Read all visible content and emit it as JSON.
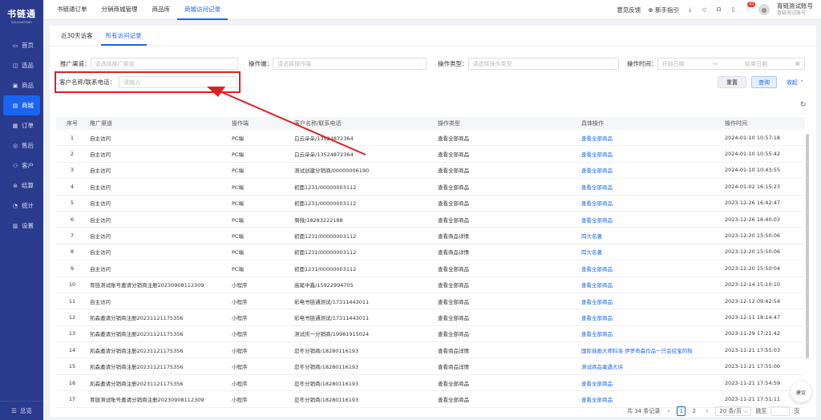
{
  "sidebar": {
    "logo": "书链通",
    "logo_sub": "SHULIANTONG",
    "items": [
      {
        "icon": "monitor-icon",
        "glyph": "▭",
        "label": "首页"
      },
      {
        "icon": "bag-icon",
        "glyph": "◫",
        "label": "选品"
      },
      {
        "icon": "box-icon",
        "glyph": "▣",
        "label": "商品"
      },
      {
        "icon": "store-icon",
        "glyph": "▤",
        "label": "商城"
      },
      {
        "icon": "order-icon",
        "glyph": "▦",
        "label": "订单"
      },
      {
        "icon": "refund-icon",
        "glyph": "◎",
        "label": "售后"
      },
      {
        "icon": "users-icon",
        "glyph": "⚇",
        "label": "客户"
      },
      {
        "icon": "settle-icon",
        "glyph": "⊛",
        "label": "结算"
      },
      {
        "icon": "stats-icon",
        "glyph": "◔",
        "label": "统计"
      },
      {
        "icon": "settings-icon",
        "glyph": "▥",
        "label": "设置"
      }
    ],
    "active_index": 3,
    "collapse_label": "总览"
  },
  "topbar": {
    "tabs": [
      "书链通订单",
      "分销商城管理",
      "商品库",
      "商城访问记录"
    ],
    "active_tab": 3,
    "feedback": "意见反馈",
    "guide": "新手指引",
    "badge": "32",
    "account_name": "育链测试账号",
    "account_sub": "育链测试账号"
  },
  "subtabs": [
    "近30天访客",
    "所有访问记录"
  ],
  "active_subtab": 1,
  "filters": {
    "channel_label": "推广渠道：",
    "channel_placeholder": "请选择推广渠道",
    "device_label": "操作端：",
    "device_placeholder": "请选择操作端",
    "type_label": "操作类型：",
    "type_placeholder": "请选择操作类型",
    "time_label": "操作时间：",
    "start_placeholder": "开始日期",
    "end_placeholder": "结束日期",
    "customer_label": "客户名称/联系电话：",
    "customer_placeholder": "请输入",
    "reset": "重置",
    "query": "查询",
    "fold": "收起"
  },
  "table": {
    "headers": [
      "序号",
      "推广渠道",
      "操作端",
      "客户名称/联系电话",
      "操作类型",
      "具体操作",
      "操作时间"
    ],
    "rows": [
      [
        "1",
        "自主访问",
        "PC端",
        "白云朵朵/13524872364",
        "查看全部商品",
        "查看全部商品",
        "2024-01-10 10:57:18"
      ],
      [
        "2",
        "自主访问",
        "PC端",
        "白云朵朵/13524872364",
        "查看全部商品",
        "查看全部商品",
        "2024-01-10 10:55:42"
      ],
      [
        "3",
        "自主访问",
        "PC端",
        "测试创建分销商/00000006190",
        "查看全部商品",
        "查看全部商品",
        "2024-01-10 10:43:55"
      ],
      [
        "4",
        "自主访问",
        "PC端",
        "初面1231/00000003112",
        "查看全部商品",
        "查看全部商品",
        "2024-01-02 16:15:23"
      ],
      [
        "5",
        "自主访问",
        "PC端",
        "初面1231/00000003112",
        "查看全部商品",
        "查看全部商品",
        "2023-12-26 16:42:47"
      ],
      [
        "6",
        "自主访问",
        "PC端",
        "周微/18283222188",
        "查看全部商品",
        "查看全部商品",
        "2023-12-26 16:40:03"
      ],
      [
        "7",
        "自主访问",
        "PC端",
        "初面1231/00000003112",
        "查看商品详情",
        "四大名著",
        "2023-12-20 15:50:06"
      ],
      [
        "8",
        "自主访问",
        "PC端",
        "初面1231/00000003112",
        "查看商品详情",
        "四大名著",
        "2023-12-20 15:50:06"
      ],
      [
        "9",
        "自主访问",
        "PC端",
        "初面1231/00000003112",
        "查看全部商品",
        "查看全部商品",
        "2023-12-20 15:50:04"
      ],
      [
        "10",
        "育链测试账号邀请分销商注册20230908112309",
        "小程序",
        "高尾中鑫/15922994705",
        "查看全部商品",
        "查看全部商品",
        "2023-12-14 15:10:10"
      ],
      [
        "11",
        "自主访问",
        "小程序",
        "彩电书链通测试/17311443011",
        "查看全部商品",
        "查看全部商品",
        "2023-12-12 09:42:54"
      ],
      [
        "12",
        "凯森邀请分销商注册20231121175356",
        "小程序",
        "彩电书链通测试/17311443011",
        "查看全部商品",
        "查看全部商品",
        "2023-12-11 18:14:47"
      ],
      [
        "13",
        "凯森邀请分销商注册20231121175356",
        "小程序",
        "测试庆一分销商/19981915024",
        "查看全部商品",
        "查看全部商品",
        "2023-11-29 17:21:42"
      ],
      [
        "14",
        "凯森邀请分销商注册20231121175356",
        "小程序",
        "忍冬分销商/18280116193",
        "查看商品详情",
        "国际插画大师科洛·伊罗奇森作品一只会挖宝的狗",
        "2023-11-21 17:55:03"
      ],
      [
        "15",
        "凯森邀请分销商注册20231121175356",
        "小程序",
        "忍冬分销商/18280116193",
        "查看商品详情",
        "测试商品毫遇大块",
        "2023-11-21 17:55:00"
      ],
      [
        "16",
        "凯森邀请分销商注册20231121175356",
        "小程序",
        "忍冬分销商/18280116193",
        "查看全部商品",
        "查看全部商品",
        "2023-11-21 17:54:59"
      ],
      [
        "17",
        "育链测试账号邀请分销商注册20230908112309",
        "小程序",
        "忍冬分销商/18280116193",
        "查看全部商品",
        "查看全部商品",
        "2023-11-21 17:51:11"
      ]
    ]
  },
  "pager": {
    "total": "共 34 条记录",
    "pages": [
      "1",
      "2"
    ],
    "page_size": "20 条/页",
    "jump_label": "跳至",
    "page_unit": "页"
  },
  "fab_label": "建议",
  "colors": {
    "sidebar": "#2a3a8c",
    "accent": "#1765f0",
    "annotation": "#e02020"
  }
}
